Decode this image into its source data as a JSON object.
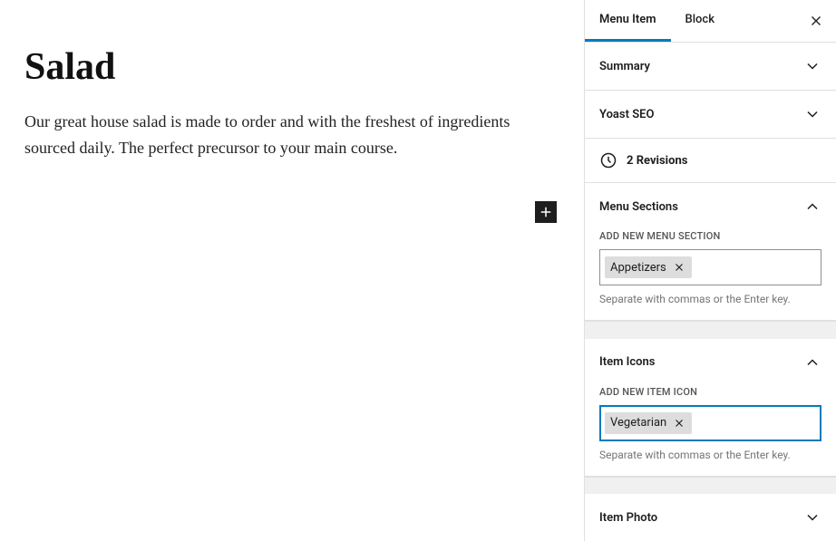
{
  "post": {
    "title": "Salad",
    "body": "Our great house salad is made to order and with the freshest of ingredients sourced daily. The perfect precursor to your main course."
  },
  "sidebar": {
    "tabs": {
      "menuItem": "Menu Item",
      "block": "Block"
    },
    "panels": {
      "summary": "Summary",
      "yoast": "Yoast SEO",
      "menuSections": "Menu Sections",
      "itemIcons": "Item Icons",
      "itemPhoto": "Item Photo"
    },
    "revisions": {
      "count": "2",
      "label": "Revisions"
    },
    "menuSections": {
      "label": "ADD NEW MENU SECTION",
      "tags": [
        "Appetizers"
      ],
      "helper": "Separate with commas or the Enter key."
    },
    "itemIcons": {
      "label": "ADD NEW ITEM ICON",
      "tags": [
        "Vegetarian"
      ],
      "helper": "Separate with commas or the Enter key."
    }
  }
}
